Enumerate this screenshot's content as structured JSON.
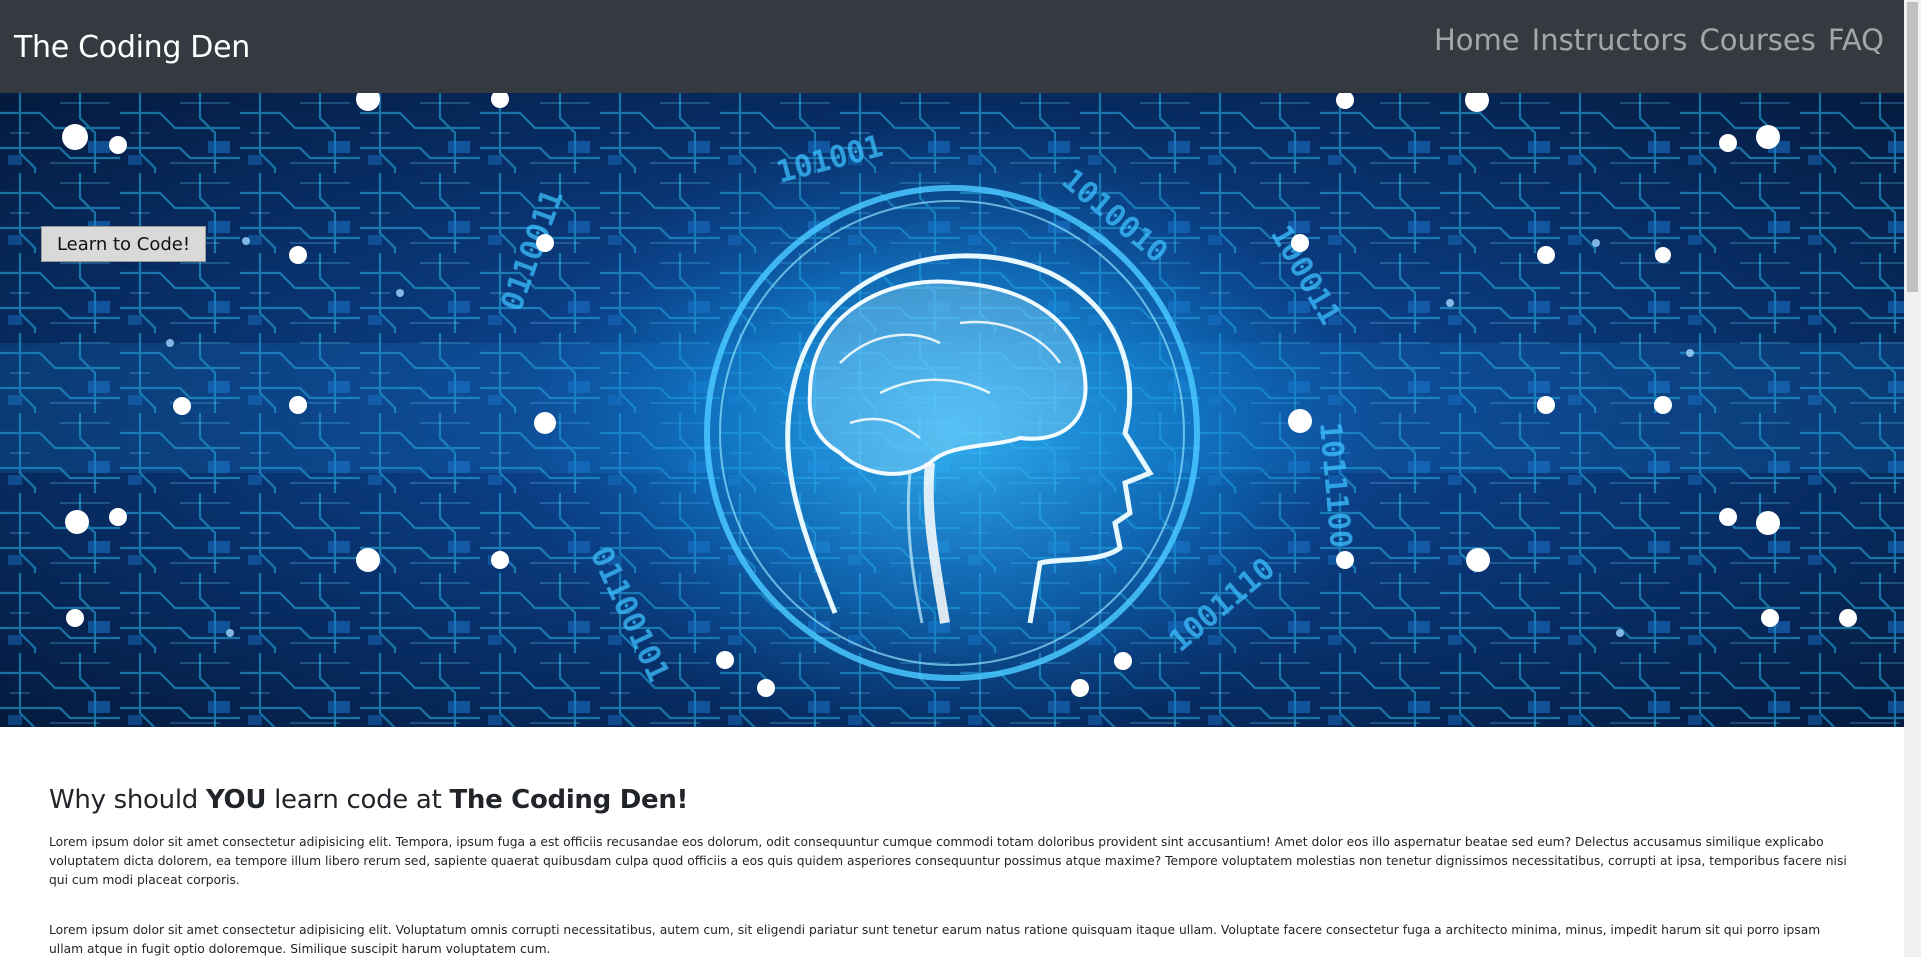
{
  "navbar": {
    "brand": "The Coding Den",
    "links": [
      "Home",
      "Instructors",
      "Courses",
      "FAQ"
    ]
  },
  "hero": {
    "button_label": "Learn to Code!",
    "image_subject": "circuit board with glowing brain profile and binary digits"
  },
  "main": {
    "heading_prefix": "Why should ",
    "heading_em1": "YOU",
    "heading_mid": " learn code at ",
    "heading_em2": "The Coding Den!",
    "paragraphs": [
      "Lorem ipsum dolor sit amet consectetur adipisicing elit. Tempora, ipsum fuga a est officiis recusandae eos dolorum, odit consequuntur cumque commodi totam doloribus provident sint accusantium! Amet dolor eos illo aspernatur beatae sed eum? Delectus accusamus similique explicabo voluptatem dicta dolorem, ea tempore illum libero rerum sed, sapiente quaerat quibusdam culpa quod officiis a eos quis quidem asperiores consequuntur possimus atque maxime? Tempore voluptatem molestias non tenetur dignissimos necessitatibus, corrupti at ipsa, temporibus facere nisi qui cum modi placeat corporis.",
      "Lorem ipsum dolor sit amet consectetur adipisicing elit. Voluptatum omnis corrupti necessitatibus, autem cum, sit eligendi pariatur sunt tenetur earum natus ratione quisquam itaque ullam. Voluptate facere consectetur fuga a architecto minima, minus, impedit harum sit qui porro ipsam ullam atque in fugit optio doloremque. Similique suscipit harum voluptatem cum."
    ]
  },
  "colors": {
    "navbar_bg": "#343a40",
    "nav_link": "rgba(255,255,255,0.55)",
    "hero_glow": "#1ea0e8"
  }
}
